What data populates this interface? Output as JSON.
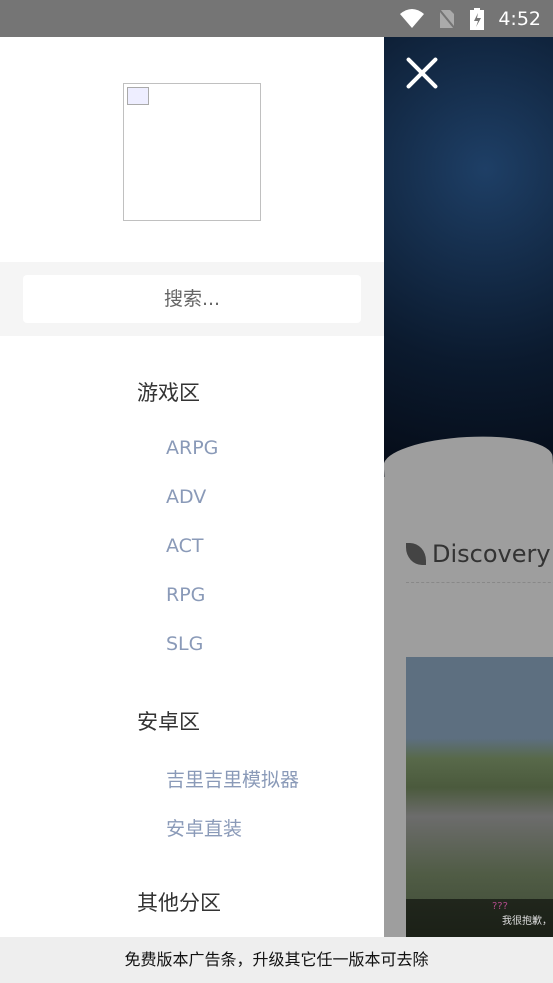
{
  "status_bar": {
    "time": "4:52",
    "icons": [
      "wifi-icon",
      "no-sim-icon",
      "battery-charging-icon"
    ]
  },
  "drawer": {
    "search_placeholder": "搜索...",
    "sections": [
      {
        "title": "游戏区",
        "items": [
          "ARPG",
          "ADV",
          "ACT",
          "RPG",
          "SLG"
        ]
      },
      {
        "title": "安卓区",
        "items": [
          "吉里吉里模拟器",
          "安卓直装"
        ]
      },
      {
        "title": "其他分区",
        "items": []
      }
    ]
  },
  "main": {
    "discovery_label": "Discovery",
    "caption_name": "???",
    "caption_text": "我很抱歉，"
  },
  "ad_banner": "免费版本广告条，升级其它任一版本可去除"
}
